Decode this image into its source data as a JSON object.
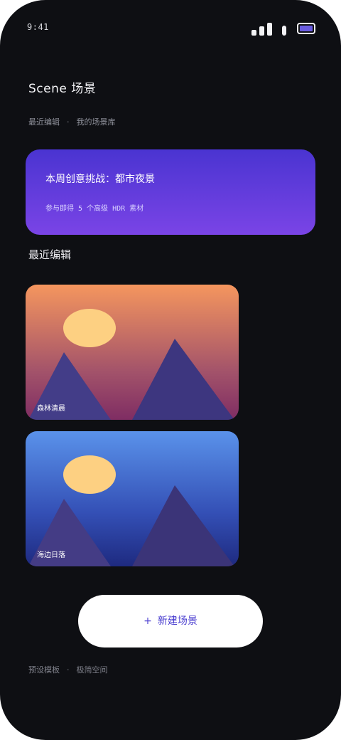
{
  "status_bar": {
    "time": "9:41",
    "icons": [
      "signal-icon",
      "wifi-icon",
      "battery-icon"
    ],
    "battery_color": "#6a5ce0"
  },
  "header": {
    "title": "Scene 场景"
  },
  "subnav": {
    "items": [
      "最近编辑",
      "我的场景库"
    ],
    "separator": "·"
  },
  "banner": {
    "title": "本周创意挑战：都市夜景",
    "subtitle": "参与即得 5 个高级 HDR 素材",
    "colors": [
      "#4a34d1",
      "#7a44e6"
    ]
  },
  "recent": {
    "section_title": "最近编辑",
    "cards": [
      {
        "label": "森林清晨",
        "icon": "landscape-icon"
      },
      {
        "label": "海边日落",
        "icon": "landscape-icon"
      }
    ]
  },
  "new_scene": {
    "plus": "+",
    "label": "新建场景"
  },
  "footer": {
    "items": [
      "预设模板",
      "极简空间"
    ],
    "separator": "·"
  }
}
